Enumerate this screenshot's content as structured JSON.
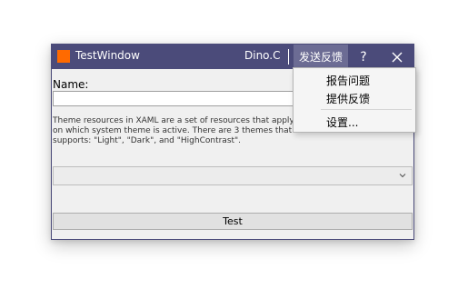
{
  "window": {
    "title": "TestWindow",
    "user": "Dino.C",
    "feedback_label": "发送反馈",
    "help_label": "?",
    "accent_color": "#4b4b7a",
    "icon_color": "#ff6a00"
  },
  "form": {
    "name_label": "Name:",
    "name_value": "",
    "description": "Theme resources in XAML are a set of resources that apply different values depending on which system theme is active. There are 3 themes that the XAML framework supports: \"Light\", \"Dark\", and \"HighContrast\".",
    "combo_value": "",
    "test_button": "Test"
  },
  "feedback_menu": {
    "items": [
      "报告问题",
      "提供反馈",
      "设置..."
    ]
  },
  "icons": [
    "app-icon",
    "close-icon",
    "chevron-down-icon"
  ]
}
